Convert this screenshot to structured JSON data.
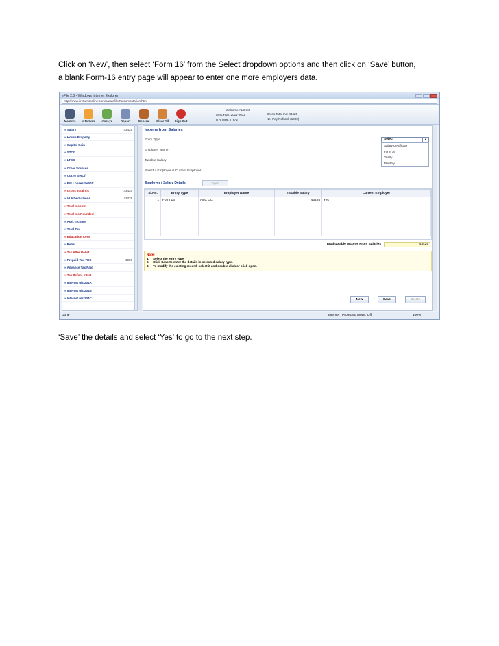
{
  "doc": {
    "para1_line1": " Click on ‘New’, then select ‘Form 16’ from the Select dropdown options and then click on ‘Save’ button,",
    "para1_line2": "a blank Form-16 entry page will appear to enter one more employers data.",
    "para2": "‘Save’ the details and select ‘Yes’ to go to the next step."
  },
  "window": {
    "title": "eFile 2.0 - Windows Internet Explorer",
    "url": "http://www.itreturnsonline.com/saralefile/Taxcomputation.html"
  },
  "toolbar": {
    "buttons": [
      "Masters",
      "e Return",
      "Asst.yr",
      "Report",
      "General",
      "Clear All",
      "Sign Out"
    ],
    "welcome": "Welcome  ALBKM",
    "asst_year": "Asst.Year:  2011-2012",
    "itr_type": "ITR Type:  ITR-2",
    "gross_total": "Gross Total Inc: 43425",
    "net_pay": "Net Pay/Refund:  (1000)"
  },
  "sidebar": {
    "items": [
      {
        "label": "Salary",
        "value": "43425",
        "color": "#1a3a8a"
      },
      {
        "label": "House Property",
        "value": "",
        "color": "#1a3a8a"
      },
      {
        "label": "Capital Gain",
        "value": "",
        "color": "#1a3a8a"
      },
      {
        "label": "STCG",
        "value": "",
        "color": "#1a3a8a"
      },
      {
        "label": "LTCG",
        "value": "",
        "color": "#1a3a8a"
      },
      {
        "label": "Other Sources",
        "value": "",
        "color": "#1a3a8a"
      },
      {
        "label": "Cur.Yr SetOff",
        "value": "",
        "color": "#1a3a8a"
      },
      {
        "label": "B/F Losses SetOff",
        "value": "",
        "color": "#1a3a8a"
      },
      {
        "label": "Gross Total Inc",
        "value": "43425",
        "color": "#c81e1e"
      },
      {
        "label": "VI A Deductions",
        "value": "43425",
        "color": "#1a3a8a"
      },
      {
        "label": "Total Income",
        "value": "",
        "color": "#c81e1e"
      },
      {
        "label": "Total Inc Rounded",
        "value": "",
        "color": "#c81e1e"
      },
      {
        "label": "Agri. Income",
        "value": "",
        "color": "#1a3a8a"
      },
      {
        "label": "Total Tax",
        "value": "",
        "color": "#1a3a8a"
      },
      {
        "label": "Education Cess",
        "value": "",
        "color": "#c81e1e"
      },
      {
        "label": "Relief",
        "value": "",
        "color": "#1a3a8a"
      },
      {
        "label": "Tax After Relief",
        "value": "",
        "color": "#c81e1e"
      },
      {
        "label": "Prepaid Tax-TDS",
        "value": "1000",
        "color": "#1a3a8a"
      },
      {
        "label": "Advance Tax Paid",
        "value": "",
        "color": "#1a3a8a"
      },
      {
        "label": "Tax Before Intrst",
        "value": "",
        "color": "#c81e1e"
      },
      {
        "label": "Interest u/s 234A",
        "value": "",
        "color": "#1a3a8a"
      },
      {
        "label": "Interest u/s 234B",
        "value": "",
        "color": "#1a3a8a"
      },
      {
        "label": "Interest u/s 234C",
        "value": "",
        "color": "#1a3a8a"
      }
    ]
  },
  "main": {
    "section_title": "Income from Salaries",
    "fields": [
      "Entry Type",
      "Employer Name",
      "Taxable Salary",
      "Select if Employer is Current Employer"
    ],
    "select_value": "Select",
    "dropdown_options": [
      "Salary Certificate",
      "Form 16",
      "Yearly",
      "Monthly"
    ],
    "subtabs": "Employer /  Salary Details",
    "open_label": "Open",
    "grid": {
      "headers": [
        "Sl.No.",
        "Entry Type",
        "Employer Name",
        "Taxable Salary",
        "Current Employer"
      ],
      "rows": [
        [
          "1",
          "Form 16",
          "ABC Ltd.",
          "43425",
          "Yes"
        ]
      ]
    },
    "total_label": "Total taxable Income From Salaries",
    "total_value": "43425",
    "notes": {
      "heading": "Note:",
      "lines": [
        {
          "no": "1.",
          "text": "Select the entry type."
        },
        {
          "no": "2.",
          "text": "Click Save to enter the details in selected salary type."
        },
        {
          "no": "3.",
          "text": "To modify the existing record, select it and double click or click open."
        }
      ]
    },
    "buttons": {
      "new": "New",
      "save": "Save",
      "delete": "Delete"
    }
  },
  "statusbar": {
    "left": "Done",
    "middle": "Internet | Protected Mode: Off",
    "zoom": "100%"
  }
}
